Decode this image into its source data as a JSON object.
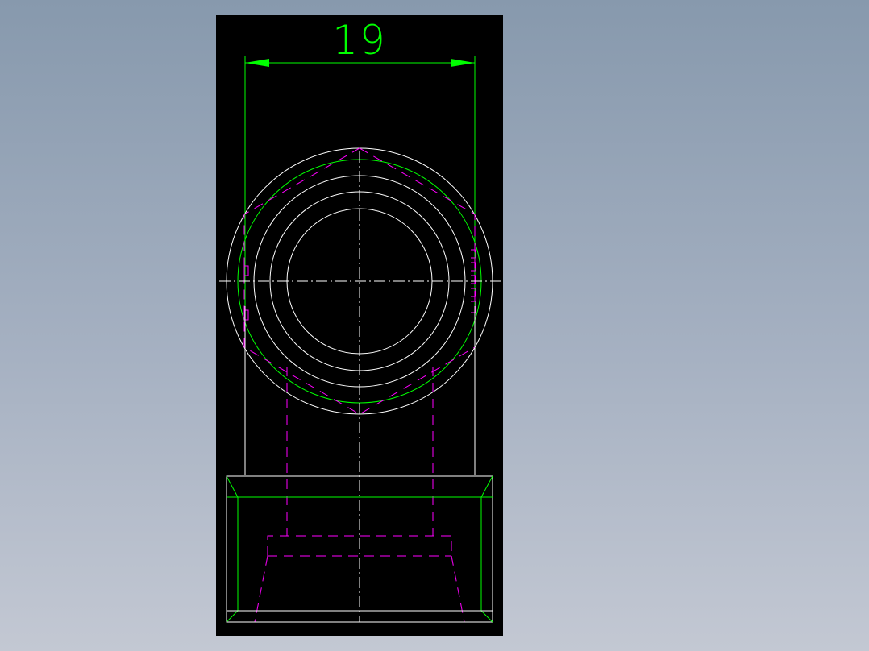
{
  "dimension": {
    "label": "19"
  },
  "colors": {
    "background_top": "#8799ad",
    "background_bottom": "#c3c8d3",
    "viewport": "#000000",
    "outline": "#ffffff",
    "dimension": "#00ff00",
    "hidden": "#ff00ff",
    "centerline": "#ffffff"
  }
}
